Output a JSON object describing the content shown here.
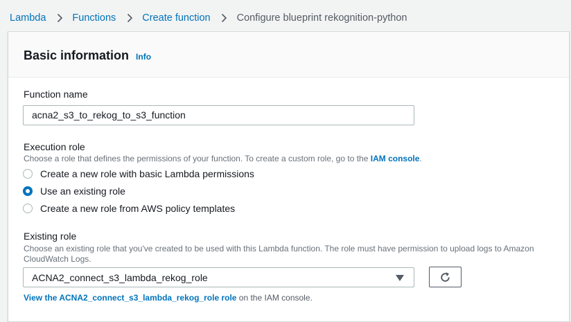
{
  "breadcrumb": {
    "items": [
      "Lambda",
      "Functions",
      "Create function"
    ],
    "current": "Configure blueprint rekognition-python"
  },
  "section": {
    "title": "Basic information",
    "info_label": "Info"
  },
  "function_name": {
    "label": "Function name",
    "value": "acna2_s3_to_rekog_to_s3_function"
  },
  "execution_role": {
    "label": "Execution role",
    "description": "Choose a role that defines the permissions of your function. To create a custom role, go to the",
    "link_text": "IAM console",
    "description_end": ".",
    "options": [
      {
        "label": "Create a new role with basic Lambda permissions",
        "checked": false
      },
      {
        "label": "Use an existing role",
        "checked": true
      },
      {
        "label": "Create a new role from AWS policy templates",
        "checked": false
      }
    ]
  },
  "existing_role": {
    "label": "Existing role",
    "description": "Choose an existing role that you've created to be used with this Lambda function. The role must have permission to upload logs to Amazon CloudWatch Logs.",
    "selected": "ACNA2_connect_s3_lambda_rekog_role",
    "view_link": "View the ACNA2_connect_s3_lambda_rekog_role role",
    "view_suffix": " on the IAM console."
  },
  "colors": {
    "link": "#0073bb",
    "text": "#16191f",
    "muted": "#687078",
    "background": "#f2f3f3"
  },
  "icons": {
    "separator": "chevron-right-icon",
    "dropdown": "caret-down-icon",
    "refresh": "refresh-icon"
  }
}
